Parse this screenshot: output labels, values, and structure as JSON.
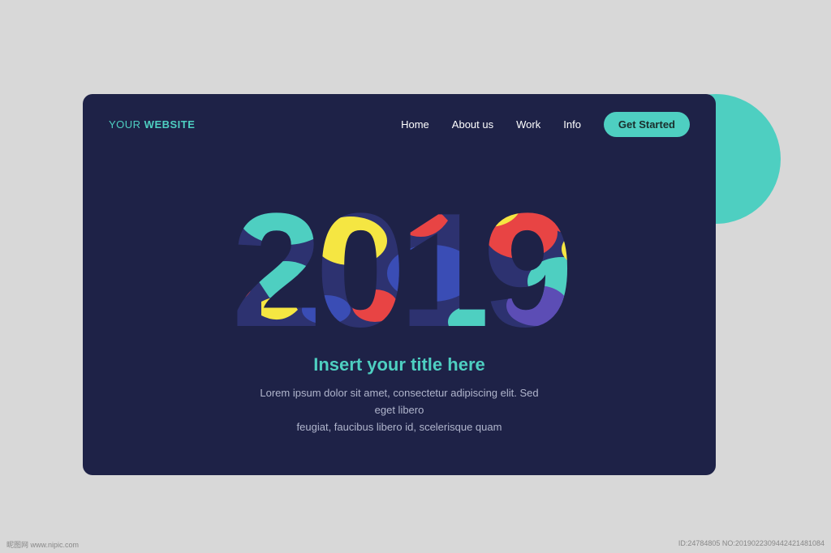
{
  "background": "#d8d8d8",
  "card": {
    "background": "#1e2247"
  },
  "logo": {
    "your": "YOUR ",
    "website": "WEBSITE"
  },
  "nav": {
    "links": [
      {
        "label": "Home",
        "id": "home"
      },
      {
        "label": "About us",
        "id": "about"
      },
      {
        "label": "Work",
        "id": "work"
      },
      {
        "label": "Info",
        "id": "info"
      }
    ],
    "cta": "Get Started"
  },
  "hero": {
    "year": "2019",
    "title": "Insert your title here",
    "description_line1": "Lorem ipsum dolor sit amet, consectetur adipiscing elit. Sed eget libero",
    "description_line2": "feugiat, faucibus libero id, scelerisque quam"
  },
  "watermark": {
    "left": "昵图网 www.nipic.com",
    "right": "ID:24784805 NO:2019022309442421481084"
  },
  "colors": {
    "teal": "#4ecfc1",
    "dark_navy": "#1e2247",
    "red": "#e84444",
    "yellow": "#f5e642",
    "blue": "#3a4db5",
    "purple": "#5c4db5"
  }
}
